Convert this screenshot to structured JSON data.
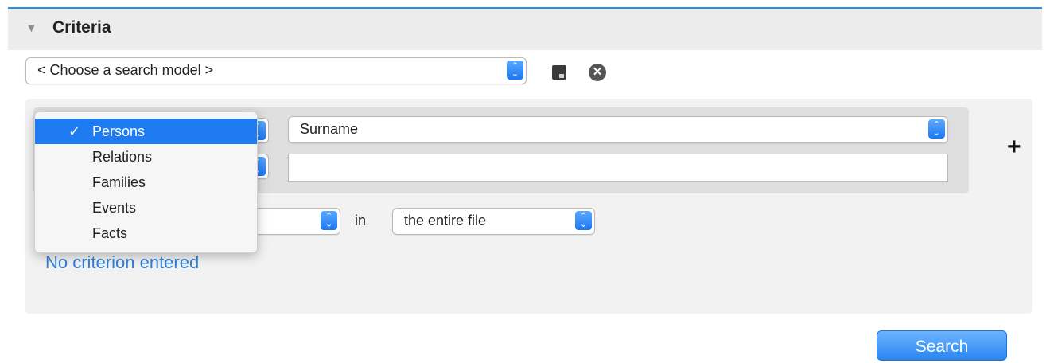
{
  "header": {
    "title": "Criteria"
  },
  "model_select": {
    "value": "< Choose a search model >"
  },
  "criteria": {
    "object_menu": {
      "items": [
        {
          "label": "Persons",
          "selected": true
        },
        {
          "label": "Relations",
          "selected": false
        },
        {
          "label": "Families",
          "selected": false
        },
        {
          "label": "Events",
          "selected": false
        },
        {
          "label": "Facts",
          "selected": false
        }
      ],
      "check": "✓"
    },
    "field_select": {
      "value": "Surname"
    },
    "value_input": {
      "value": ""
    },
    "scope": {
      "in_label": "in",
      "file_value": "the entire file"
    },
    "status": "No criterion entered"
  },
  "actions": {
    "search_label": "Search"
  },
  "colors": {
    "accent": "#1f7bf2",
    "link": "#2f7fd6"
  },
  "icons": [
    "disclosure-triangle-icon",
    "save-icon",
    "clear-icon",
    "plus-icon",
    "stepper-icon",
    "checkmark-icon"
  ]
}
